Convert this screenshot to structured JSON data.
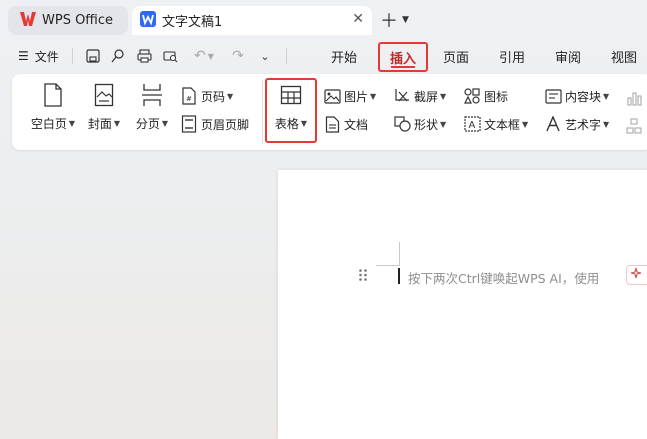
{
  "tabs": {
    "wps": "WPS Office",
    "document": "文字文稿1"
  },
  "menubar": {
    "file": "文件",
    "ribbon_tabs": [
      "开始",
      "插入",
      "页面",
      "引用",
      "审阅",
      "视图"
    ],
    "active_tab": "插入"
  },
  "ribbon": {
    "blank_page": "空白页",
    "cover": "封面",
    "section": "分页",
    "page_number": "页码",
    "header_footer": "页眉页脚",
    "table": "表格",
    "picture": "图片",
    "document": "文档",
    "screenshot": "截屏",
    "shape": "形状",
    "icon": "图标",
    "textbox": "文本框",
    "content_control": "内容块",
    "wordart": "艺术字"
  },
  "document": {
    "hint": "按下两次Ctrl键唤起WPS AI，使用"
  },
  "colors": {
    "accent": "#e53935",
    "wps_brand": "#e53935",
    "doc_icon": "#2f6bf1"
  }
}
